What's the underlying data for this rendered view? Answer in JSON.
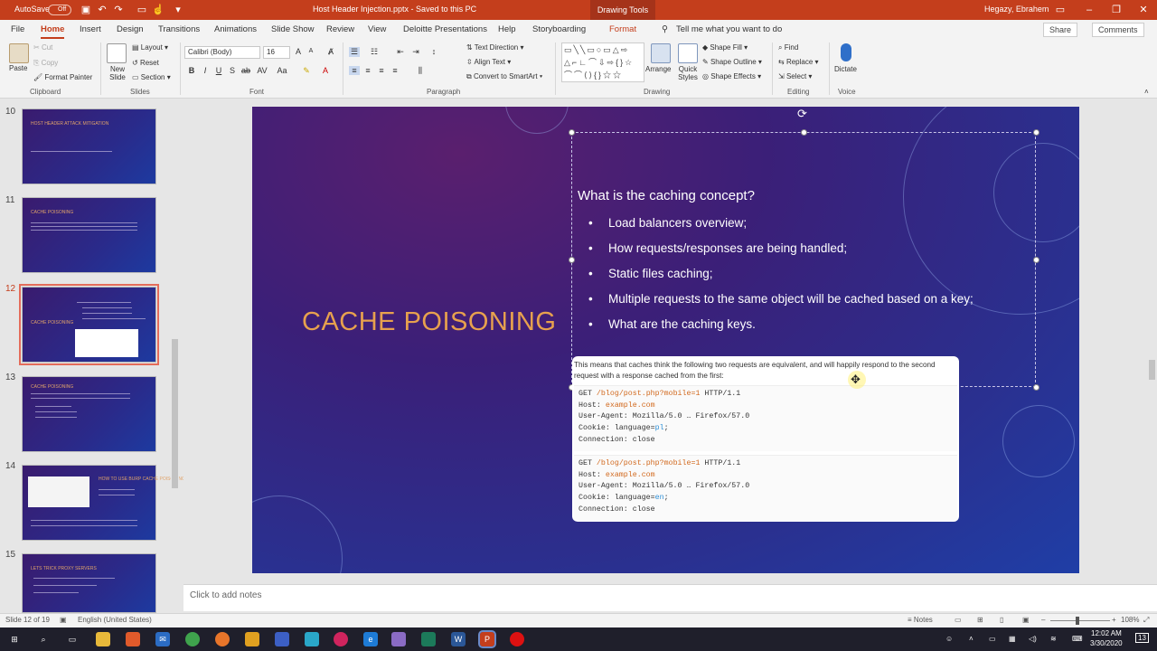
{
  "titlebar": {
    "autosave_label": "AutoSave",
    "autosave_state": "Off",
    "doc_title": "Host Header Injection.pptx - Saved to this PC",
    "context_label": "Drawing Tools",
    "user": "Hegazy, Ebrahem"
  },
  "tabs": [
    "File",
    "Home",
    "Insert",
    "Design",
    "Transitions",
    "Animations",
    "Slide Show",
    "Review",
    "View",
    "Deloitte Presentations",
    "Help",
    "Storyboarding",
    "Format"
  ],
  "tell_me": "Tell me what you want to do",
  "share_label": "Share",
  "comments_label": "Comments",
  "ribbon": {
    "clipboard": {
      "paste": "Paste",
      "cut": "Cut",
      "copy": "Copy",
      "format_painter": "Format Painter",
      "group": "Clipboard"
    },
    "slides": {
      "new_slide": "New Slide",
      "layout": "Layout",
      "reset": "Reset",
      "section": "Section",
      "group": "Slides"
    },
    "font": {
      "name": "Calibri (Body)",
      "size": "16",
      "group": "Font"
    },
    "paragraph": {
      "text_direction": "Text Direction",
      "align_text": "Align Text",
      "convert": "Convert to SmartArt",
      "group": "Paragraph"
    },
    "drawing": {
      "arrange": "Arrange",
      "quick_styles": "Quick Styles",
      "shape_fill": "Shape Fill",
      "shape_outline": "Shape Outline",
      "shape_effects": "Shape Effects",
      "group": "Drawing"
    },
    "editing": {
      "find": "Find",
      "replace": "Replace",
      "select": "Select",
      "group": "Editing"
    },
    "voice": {
      "dictate": "Dictate",
      "group": "Voice"
    }
  },
  "thumbnails": [
    {
      "num": "10",
      "title": "HOST HEADER ATTACK MITIGATION"
    },
    {
      "num": "11",
      "title": "CACHE POISONING"
    },
    {
      "num": "12",
      "title": "CACHE POISONING"
    },
    {
      "num": "13",
      "title": "CACHE POISONING"
    },
    {
      "num": "14",
      "title": "HOW TO USE BURP CACHE POISONING"
    },
    {
      "num": "15",
      "title": "LETS TRICK PROXY SERVERS"
    }
  ],
  "slide": {
    "title": "CACHE POISONING",
    "question": "What is the caching concept?",
    "bullets": [
      "Load balancers overview;",
      "How requests/responses are being handled;",
      "Static files caching;",
      "Multiple requests to the same object will be cached based on a key;",
      "What are the caching keys."
    ],
    "card_intro": "This means that caches think the following two requests are equivalent, and will happily respond to the second request with a response cached from the first:",
    "req1": {
      "line1_a": "GET ",
      "line1_path": "/blog/post.php?mobile=1",
      "line1_b": " HTTP/1.1",
      "host_a": "Host: ",
      "host_v": "example.com",
      "ua": "User-Agent: Mozilla/5.0 … Firefox/57.0",
      "cookie_a": "Cookie: language=",
      "cookie_v": "pl",
      "cookie_b": ";",
      "conn": "Connection: close"
    },
    "req2": {
      "line1_a": "GET ",
      "line1_path": "/blog/post.php?mobile=1",
      "line1_b": " HTTP/1.1",
      "host_a": "Host: ",
      "host_v": "example.com",
      "ua": "User-Agent: Mozilla/5.0 … Firefox/57.0",
      "cookie_a": "Cookie: language=",
      "cookie_v": "en",
      "cookie_b": ";",
      "conn": "Connection: close"
    }
  },
  "notes_placeholder": "Click to add notes",
  "status": {
    "slide": "Slide 12 of 19",
    "language": "English (United States)",
    "notes": "Notes",
    "zoom": "108%"
  },
  "taskbar": {
    "time": "12:02 AM",
    "date": "3/30/2020",
    "notif": "13"
  },
  "colors": {
    "accent": "#c43e1c",
    "slide_title": "#e7a14e",
    "code_orange": "#d2691e",
    "code_blue": "#2f8fd6"
  }
}
